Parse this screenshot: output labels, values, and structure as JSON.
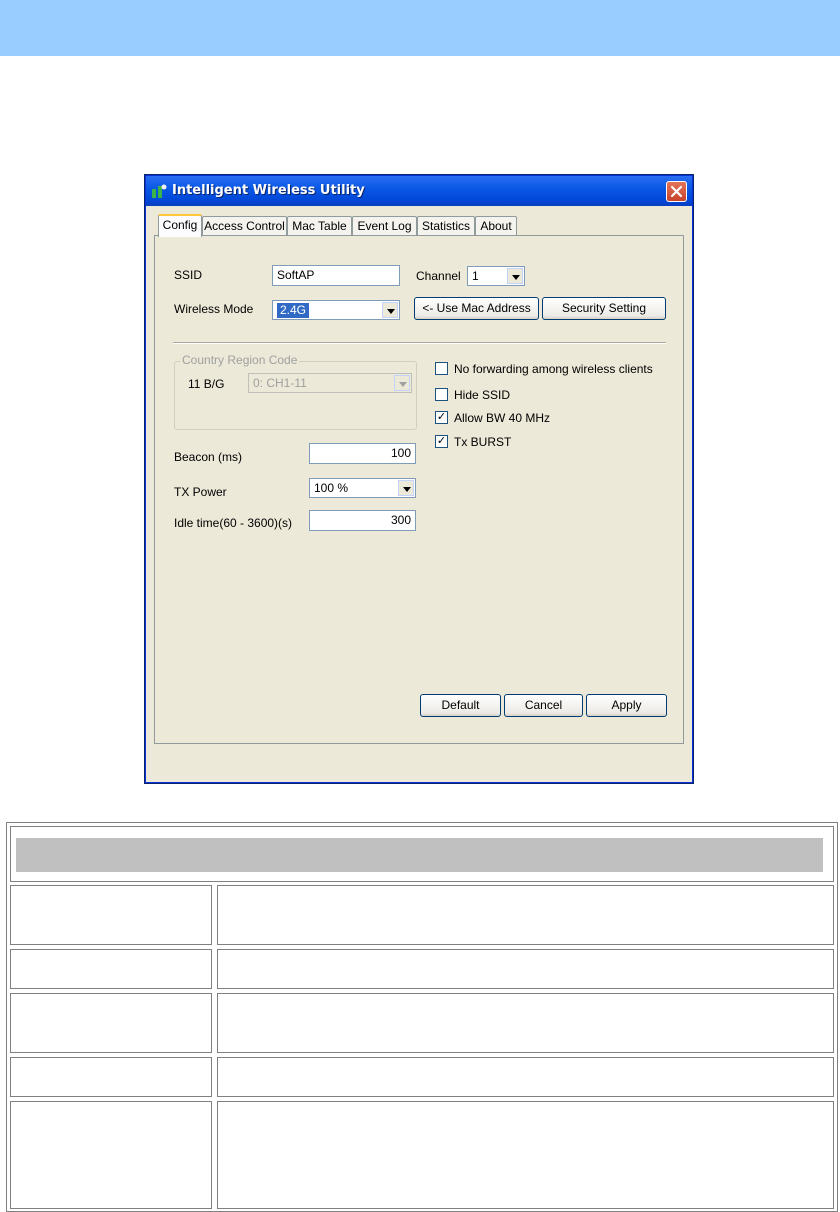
{
  "window": {
    "title": "Intelligent Wireless Utility",
    "tabs": [
      "Config",
      "Access Control",
      "Mac Table",
      "Event Log",
      "Statistics",
      "About"
    ],
    "active_tab": "Config"
  },
  "config": {
    "ssid_label": "SSID",
    "ssid_value": "SoftAP",
    "channel_label": "Channel",
    "channel_value": "1",
    "wireless_mode_label": "Wireless Mode",
    "wireless_mode_value": "2.4G",
    "use_mac_button": "<- Use Mac Address",
    "security_button": "Security Setting",
    "country_group_label": "Country Region Code",
    "band_label": "11 B/G",
    "region_value": "0: CH1-11",
    "beacon_label": "Beacon (ms)",
    "beacon_value": "100",
    "tx_power_label": "TX Power",
    "tx_power_value": "100 %",
    "idle_label": "Idle time(60 - 3600)(s)",
    "idle_value": "300",
    "checkboxes": [
      {
        "label": "No forwarding among wireless clients",
        "checked": false
      },
      {
        "label": "Hide SSID",
        "checked": false
      },
      {
        "label": "Allow BW 40 MHz",
        "checked": true
      },
      {
        "label": "Tx BURST",
        "checked": true
      }
    ],
    "default_button": "Default",
    "cancel_button": "Cancel",
    "apply_button": "Apply"
  },
  "colors": {
    "header_band": "#99ccff",
    "title_bar": "#0b59e6",
    "dialog_bg": "#ece9d8",
    "selection": "#316ac5",
    "table_header": "#c0c0c0"
  }
}
